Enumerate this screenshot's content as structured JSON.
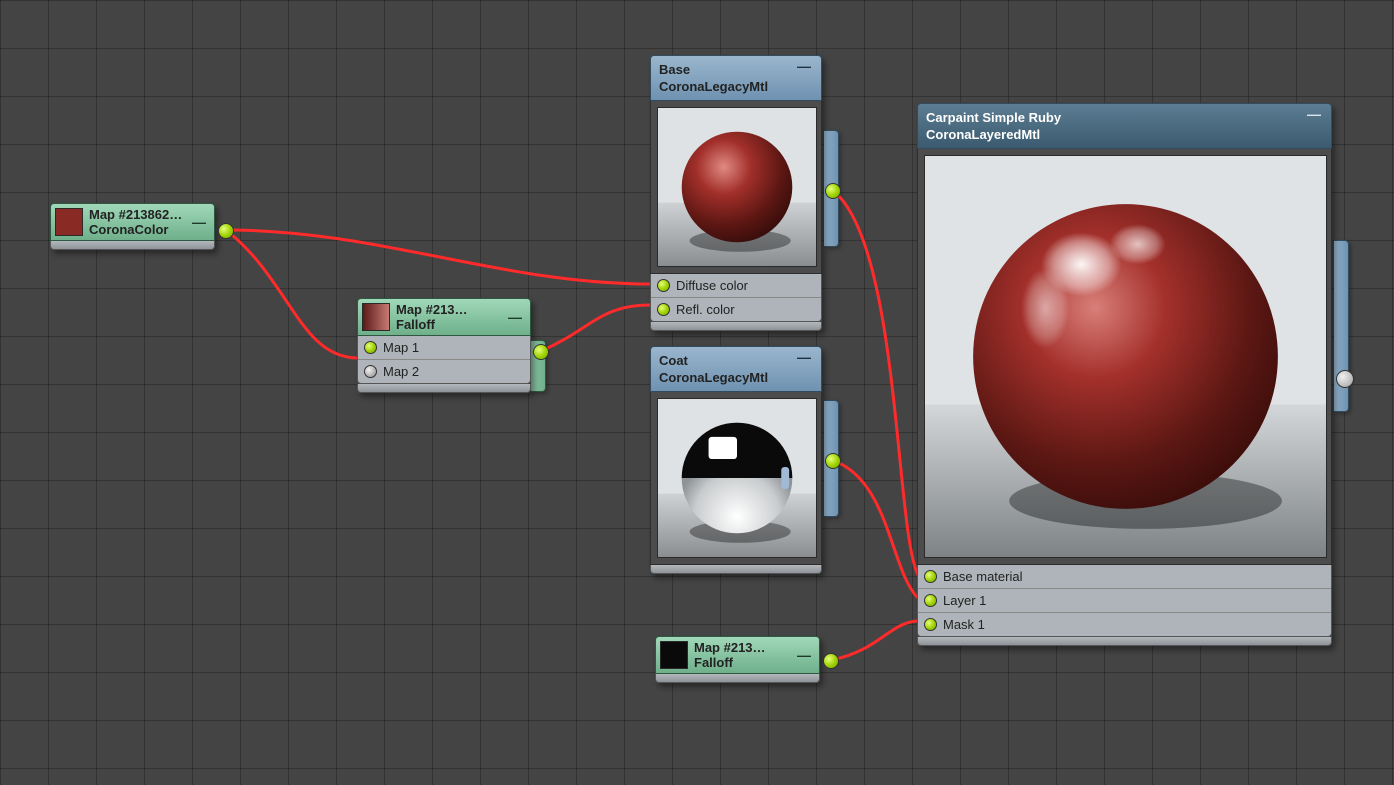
{
  "nodes": {
    "corona_color": {
      "title": "Map #213862…",
      "type": "CoronaColor",
      "swatch": "#8a2a24"
    },
    "falloff1": {
      "title": "Map #213…",
      "type": "Falloff",
      "slots": {
        "map1": "Map 1",
        "map2": "Map 2"
      },
      "swatch_gradient": [
        "#5a1b18",
        "#c97a73"
      ]
    },
    "falloff2": {
      "title": "Map #213…",
      "type": "Falloff",
      "swatch": "#0a0a0a"
    },
    "base_mtl": {
      "title": "Base",
      "type": "CoronaLegacyMtl",
      "slots": {
        "diffuse": "Diffuse color",
        "refl": "Refl. color"
      }
    },
    "coat_mtl": {
      "title": "Coat",
      "type": "CoronaLegacyMtl"
    },
    "layered_mtl": {
      "title": "Carpaint Simple Ruby",
      "type": "CoronaLayeredMtl",
      "slots": {
        "base": "Base material",
        "layer1": "Layer 1",
        "mask1": "Mask 1"
      }
    }
  }
}
